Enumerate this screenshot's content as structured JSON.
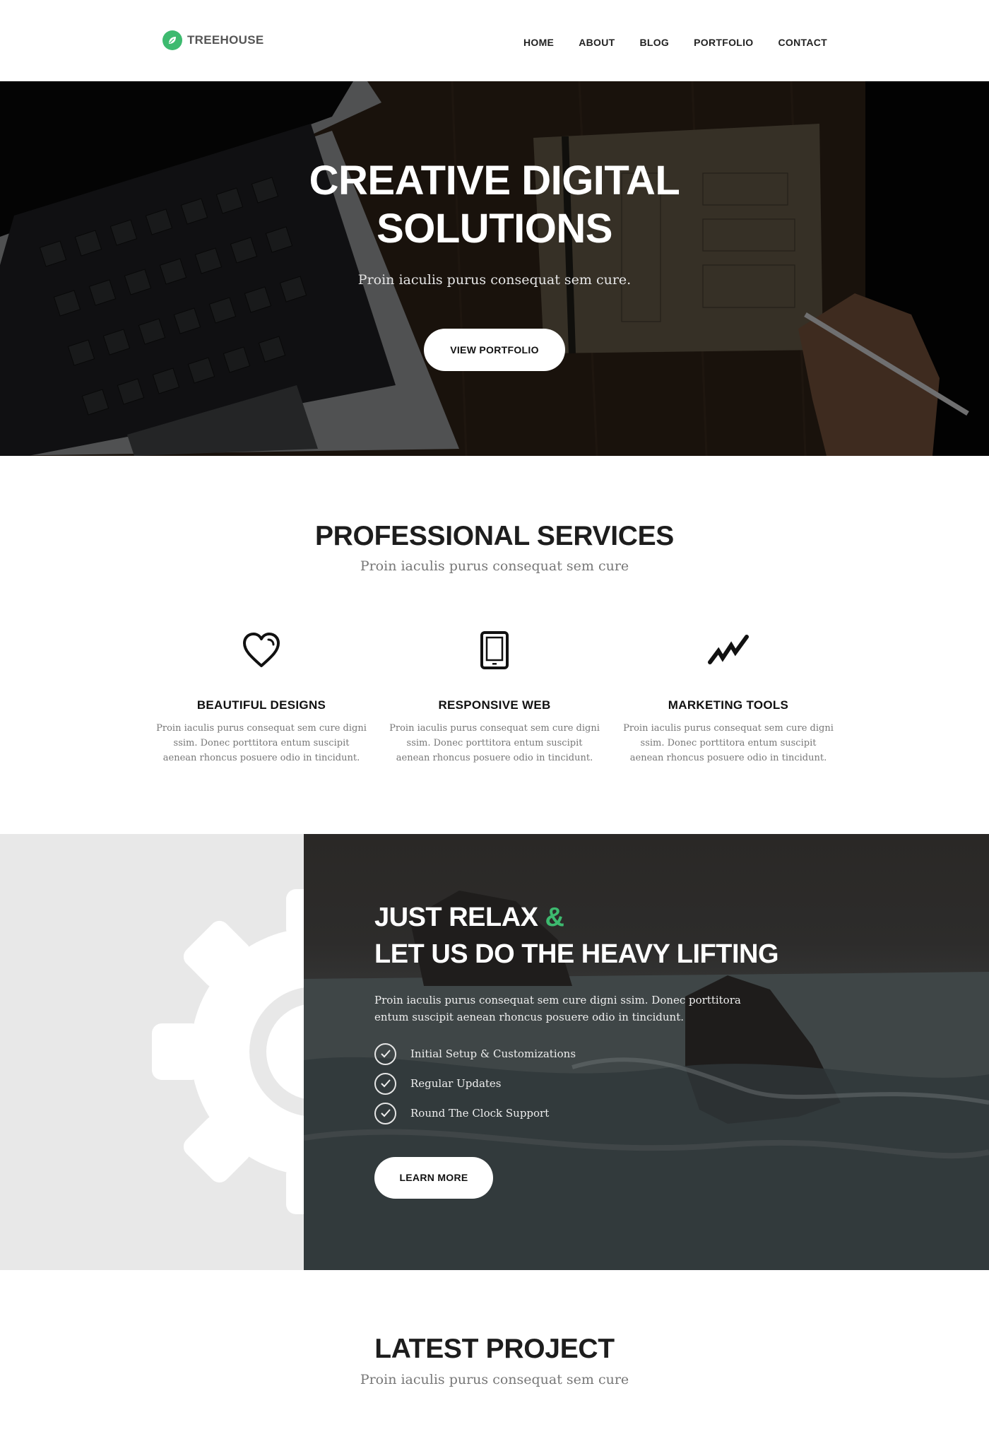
{
  "brand": {
    "name": "TREEHOUSE",
    "accent": "#3dba6f"
  },
  "nav": [
    {
      "label": "HOME"
    },
    {
      "label": "ABOUT"
    },
    {
      "label": "BLOG"
    },
    {
      "label": "PORTFOLIO"
    },
    {
      "label": "CONTACT"
    }
  ],
  "hero": {
    "title_line1": "CREATIVE DIGITAL",
    "title_line2": "SOLUTIONS",
    "subtitle": "Proin iaculis purus consequat sem cure.",
    "button": "VIEW PORTFOLIO"
  },
  "services": {
    "title": "PROFESSIONAL SERVICES",
    "subtitle": "Proin iaculis purus consequat sem cure",
    "items": [
      {
        "icon": "heart-icon",
        "title": "BEAUTIFUL DESIGNS",
        "text": "Proin iaculis purus consequat sem cure digni ssim. Donec porttitora entum suscipit aenean rhoncus posuere odio in tincidunt."
      },
      {
        "icon": "tablet-icon",
        "title": "RESPONSIVE WEB",
        "text": "Proin iaculis purus consequat sem cure digni ssim. Donec porttitora entum suscipit aenean rhoncus posuere odio in tincidunt."
      },
      {
        "icon": "chart-line-icon",
        "title": "MARKETING TOOLS",
        "text": "Proin iaculis purus consequat sem cure digni ssim. Donec porttitora entum suscipit aenean rhoncus posuere odio in tincidunt."
      }
    ]
  },
  "relax": {
    "title_line1": "JUST RELAX",
    "amp": "&",
    "title_line2": "LET US DO THE HEAVY LIFTING",
    "text": "Proin iaculis purus consequat sem cure  digni ssim. Donec porttitora entum suscipit  aenean rhoncus posuere odio in tincidunt.",
    "checklist": [
      {
        "label": "Initial Setup & Customizations"
      },
      {
        "label": "Regular Updates"
      },
      {
        "label": "Round The Clock Support"
      }
    ],
    "button": "LEARN MORE"
  },
  "latest": {
    "title": "LATEST PROJECT",
    "subtitle": "Proin iaculis purus consequat sem cure"
  }
}
